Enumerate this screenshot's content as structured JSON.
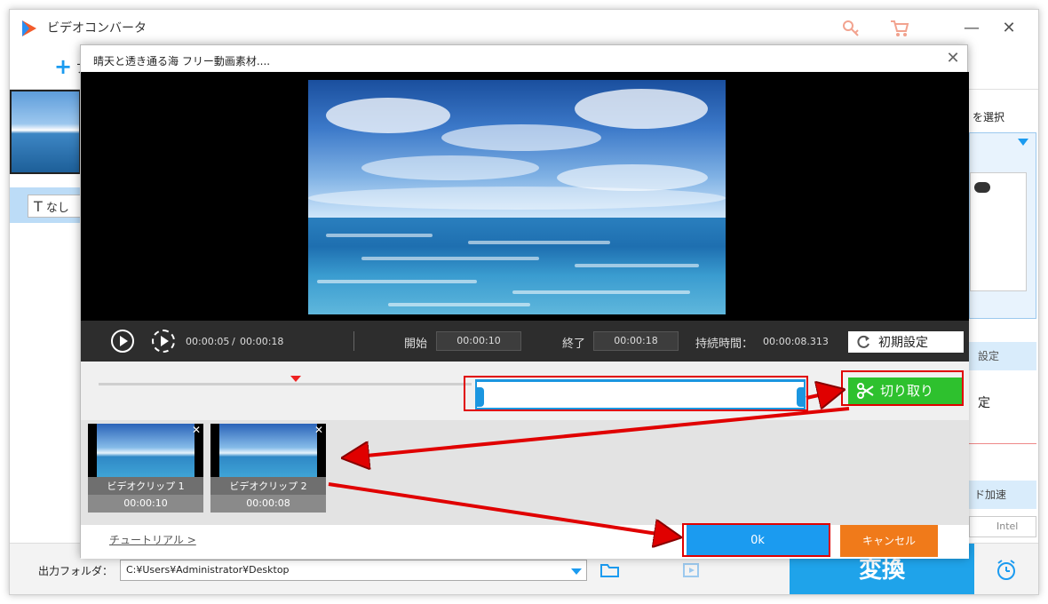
{
  "app": {
    "title": "ビデオコンバータ",
    "minimize": "—",
    "maximize": "☐",
    "close": "✕"
  },
  "toolbar": {
    "add_label": "+",
    "add_text": "フ"
  },
  "left_panel": {
    "subtitle_value": "なし"
  },
  "right_panel": {
    "format_label": "を選択",
    "settings_label": "設定",
    "settings2_label": "定",
    "accel_label": "ド加速",
    "intel_label": "Intel"
  },
  "bottom": {
    "output_folder_label": "出力フォルダ：",
    "output_path": "C:¥Users¥Administrator¥Desktop",
    "convert_label": "変換"
  },
  "dialog": {
    "title": "晴天と透き通る海 フリー動画素材....",
    "close": "✕",
    "controls": {
      "current_time": "00:00:05",
      "separator": "/",
      "total_time": "00:00:18",
      "start_label": "開始",
      "start_value": "00:00:10",
      "end_label": "終了",
      "end_value": "00:00:18",
      "duration_label": "持続時間：",
      "duration_value": "00:00:08.313",
      "reset_label": "初期設定"
    },
    "cut_label": "切り取り",
    "clips": [
      {
        "name": "ビデオクリップ 1",
        "duration": "00:00:10"
      },
      {
        "name": "ビデオクリップ 2",
        "duration": "00:00:08"
      }
    ],
    "tutorial_label": "チュートリアル >",
    "ok_label": "0k",
    "cancel_label": "キャンセル"
  },
  "colors": {
    "accent_blue": "#1b9bf0",
    "cut_green": "#2ec12e",
    "cancel_orange": "#f07a1a",
    "annotation_red": "#e00000"
  }
}
